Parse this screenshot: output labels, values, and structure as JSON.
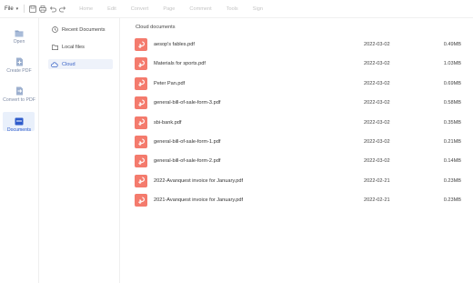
{
  "toolbar": {
    "file_label": "File",
    "menu": [
      "Home",
      "Edit",
      "Convert",
      "Page",
      "Comment",
      "Tools",
      "Sign"
    ]
  },
  "rail": [
    {
      "label": "Open",
      "icon": "folder-icon"
    },
    {
      "label": "Create PDF",
      "icon": "create-pdf-icon"
    },
    {
      "label": "Convert to PDF",
      "icon": "convert-pdf-icon"
    },
    {
      "label": "Documents",
      "icon": "documents-icon",
      "active": true
    }
  ],
  "nav": [
    {
      "label": "Recent Documents",
      "icon": "clock-icon"
    },
    {
      "label": "Local files",
      "icon": "folder-icon"
    },
    {
      "label": "Cloud",
      "icon": "cloud-icon",
      "active": true
    }
  ],
  "main": {
    "title": "Cloud documents",
    "files": [
      {
        "name": "aesop's fables.pdf",
        "date": "2022-03-02",
        "size": "0.49MB"
      },
      {
        "name": "Materials for sports.pdf",
        "date": "2022-03-02",
        "size": "1.03MB"
      },
      {
        "name": "Peter Pan.pdf",
        "date": "2022-03-02",
        "size": "0.69MB"
      },
      {
        "name": "general-bill-of-sale-form-3.pdf",
        "date": "2022-03-02",
        "size": "0.58MB"
      },
      {
        "name": "sbi-bank.pdf",
        "date": "2022-03-02",
        "size": "0.35MB"
      },
      {
        "name": "general-bill-of-sale-form-1.pdf",
        "date": "2022-03-02",
        "size": "0.21MB"
      },
      {
        "name": "general-bill-of-sale-form-2.pdf",
        "date": "2022-03-02",
        "size": "0.14MB"
      },
      {
        "name": "2022-Avanquest invoice for January.pdf",
        "date": "2022-02-21",
        "size": "0.23MB"
      },
      {
        "name": "2021-Avanquest invoice for January.pdf",
        "date": "2022-02-21",
        "size": "0.23MB"
      }
    ]
  },
  "colors": {
    "accent": "#2f5ccb",
    "pdf_badge": "#f47b6d",
    "disabled_menu": "#c4c4c4"
  }
}
